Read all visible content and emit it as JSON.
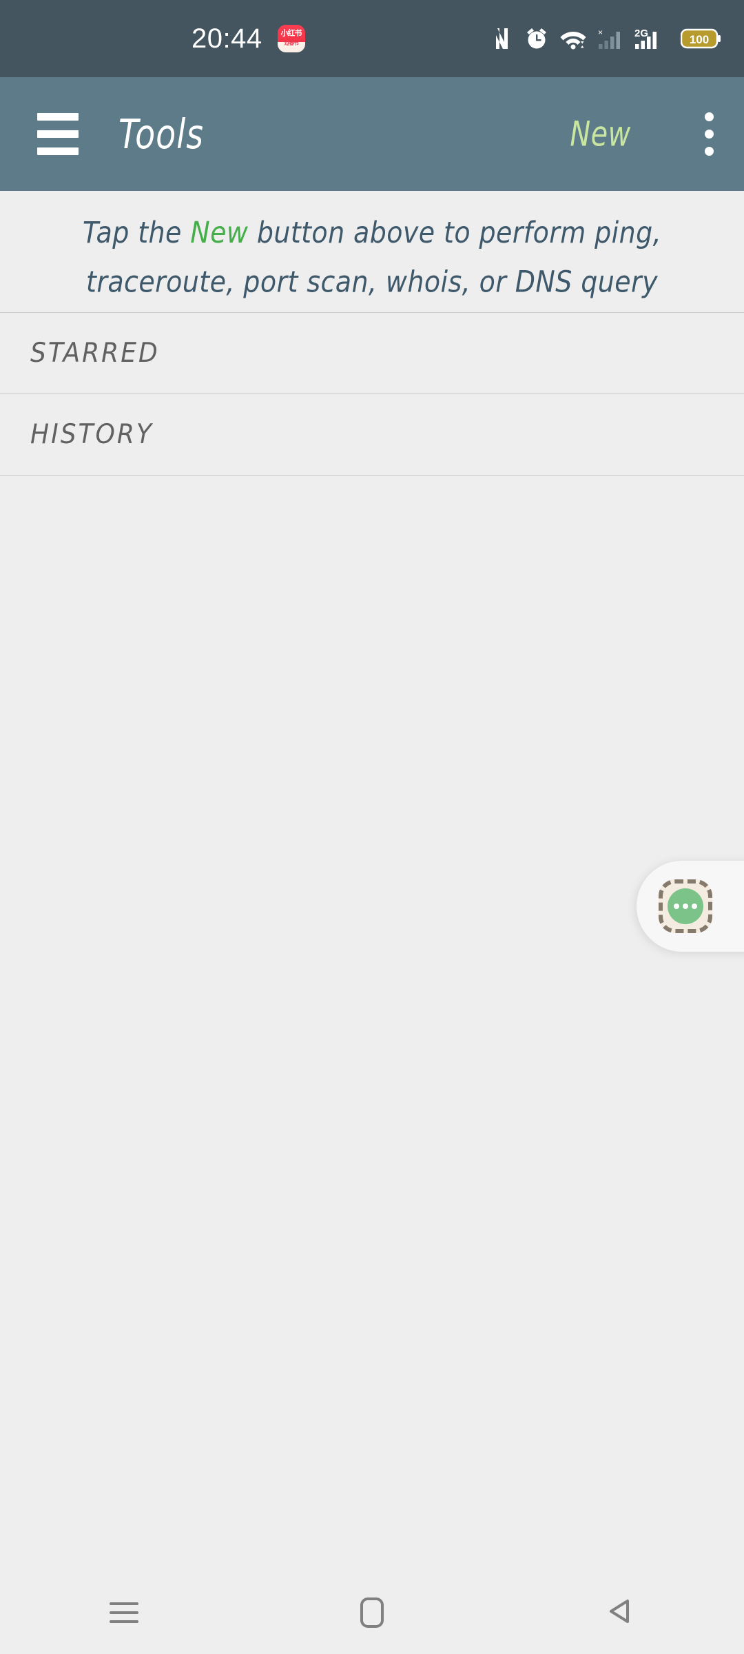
{
  "statusbar": {
    "time": "20:44",
    "notification_icon": {
      "name": "xiaohongshu-notification-icon",
      "line1": "小红书",
      "line2": "过春节"
    },
    "icons": [
      "nfc-icon",
      "alarm-clock-icon",
      "wifi-icon",
      "signal-no-service-icon",
      "cellular-2g-signal-icon",
      "battery-icon"
    ],
    "battery_level": "100",
    "network_type": "2G",
    "background_color": "#44555f"
  },
  "appbar": {
    "menu_icon": "hamburger-menu-icon",
    "title": "Tools",
    "new_label": "New",
    "overflow_icon": "more-vertical-icon",
    "background_color": "#5d7b88",
    "new_color": "#c8e6a0"
  },
  "main": {
    "hint": {
      "before": "Tap the ",
      "keyword": "New",
      "after": " button above to perform ping, traceroute, port scan, whois, or DNS query",
      "keyword_color": "#46ad4b",
      "text_color": "#3e596b"
    },
    "sections": [
      {
        "label": "STARRED",
        "items": []
      },
      {
        "label": "HISTORY",
        "items": []
      }
    ],
    "background_color": "#eeeeee"
  },
  "floating_assistant": {
    "name": "floating-assistant-button",
    "icon": "three-dots-circle-icon",
    "circle_color": "#7cc389",
    "square_color": "#f4ece0",
    "border_color": "#857a6b"
  },
  "navbar": {
    "buttons": [
      {
        "name": "nav-recents-button",
        "icon": "recents-icon"
      },
      {
        "name": "nav-home-button",
        "icon": "home-icon"
      },
      {
        "name": "nav-back-button",
        "icon": "back-triangle-icon"
      }
    ],
    "color": "#808080"
  }
}
